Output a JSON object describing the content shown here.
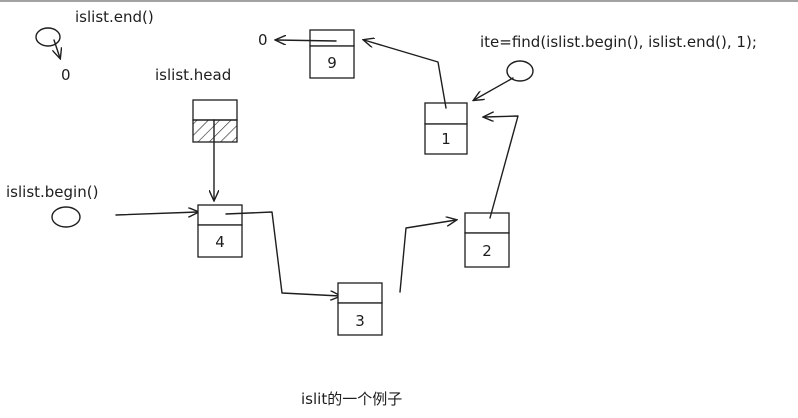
{
  "labels": {
    "end": "islist.end()",
    "end_zero": "0",
    "head": "islist.head",
    "begin": "islist.begin()",
    "ite": "ite=find(islist.begin(), islist.end(), 1);",
    "top_zero": "0",
    "caption": "islit的一个例子"
  },
  "nodes": {
    "n9": "9",
    "n1": "1",
    "n4": "4",
    "n3": "3",
    "n2": "2"
  }
}
